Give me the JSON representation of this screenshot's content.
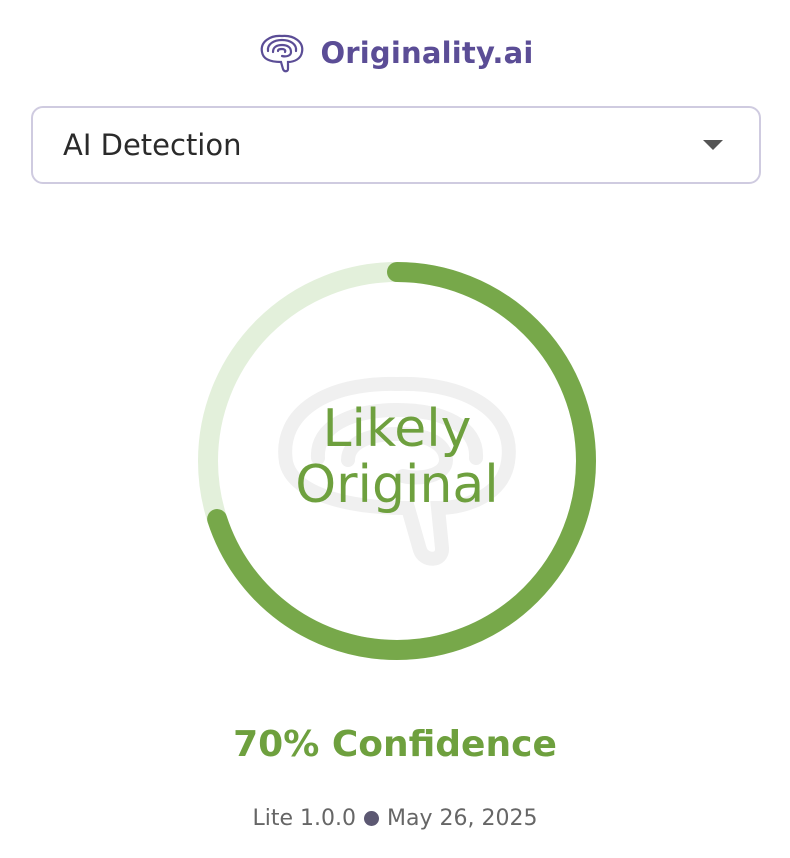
{
  "brand": {
    "name": "Originality.ai",
    "icon": "brain-icon",
    "color": "#5b4d96"
  },
  "mode_select": {
    "value": "AI Detection",
    "icon": "chevron-down-icon"
  },
  "result": {
    "label_line1": "Likely",
    "label_line2": "Original",
    "progress_fraction": 0.7,
    "progress_color": "#77a84a",
    "track_color": "#e3f0db",
    "text_color": "#6ea03e"
  },
  "confidence": {
    "text": "70% Confidence"
  },
  "footer": {
    "version": "Lite 1.0.0",
    "date": "May 26, 2025"
  }
}
